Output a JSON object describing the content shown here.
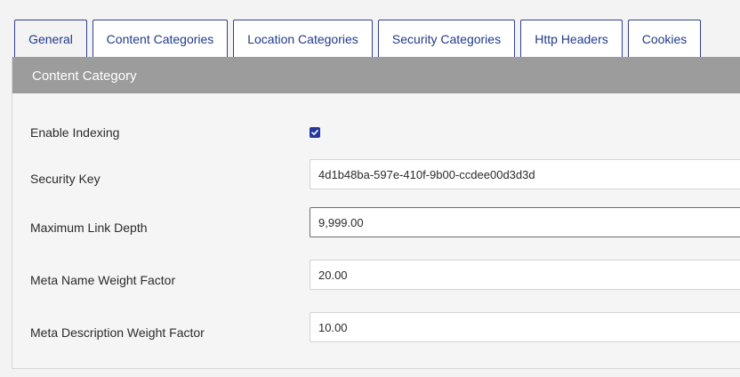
{
  "tabs": [
    {
      "label": "General",
      "active": true
    },
    {
      "label": "Content Categories",
      "active": false
    },
    {
      "label": "Location Categories",
      "active": false
    },
    {
      "label": "Security Categories",
      "active": false
    },
    {
      "label": "Http Headers",
      "active": false
    },
    {
      "label": "Cookies",
      "active": false
    }
  ],
  "panel": {
    "title": "Content Category"
  },
  "form": {
    "enable_indexing": {
      "label": "Enable Indexing",
      "checked": true
    },
    "security_key": {
      "label": "Security Key",
      "value": "4d1b48ba-597e-410f-9b00-ccdee00d3d3d"
    },
    "max_link_depth": {
      "label": "Maximum Link Depth",
      "value": "9,999.00"
    },
    "meta_name_weight": {
      "label": "Meta Name Weight Factor",
      "value": "20.00"
    },
    "meta_desc_weight": {
      "label": "Meta Description Weight Factor",
      "value": "10.00"
    }
  },
  "colors": {
    "accent": "#24399b",
    "tab_border": "#2f3f8f",
    "header_bg": "#9c9c9c"
  }
}
